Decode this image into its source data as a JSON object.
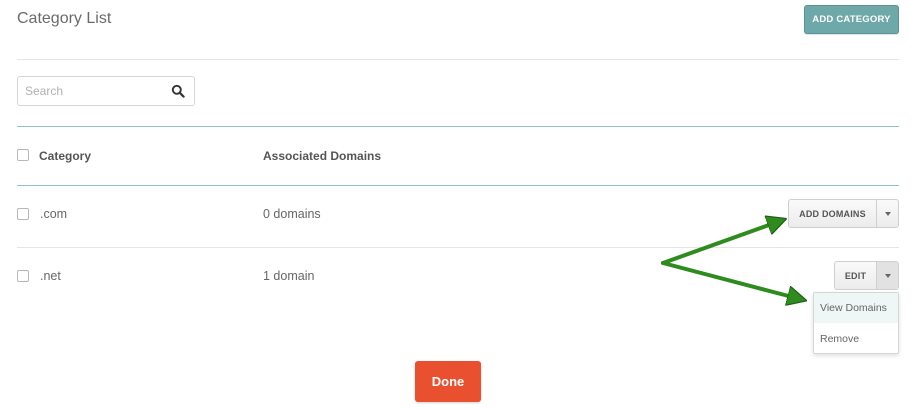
{
  "header": {
    "title": "Category List",
    "add_category_label": "ADD CATEGORY"
  },
  "search": {
    "placeholder": "Search",
    "value": ""
  },
  "table": {
    "columns": [
      "Category",
      "Associated Domains"
    ],
    "rows": [
      {
        "category": ".com",
        "domains": "0 domains",
        "action_label": "ADD DOMAINS"
      },
      {
        "category": ".net",
        "domains": "1 domain",
        "action_label": "EDIT"
      }
    ]
  },
  "dropdown": {
    "items": [
      "View Domains",
      "Remove"
    ]
  },
  "footer": {
    "done_label": "Done"
  },
  "colors": {
    "accent_teal": "#6fa8a8",
    "done_red": "#e8502f",
    "annotation_green": "#2e8b1e"
  }
}
